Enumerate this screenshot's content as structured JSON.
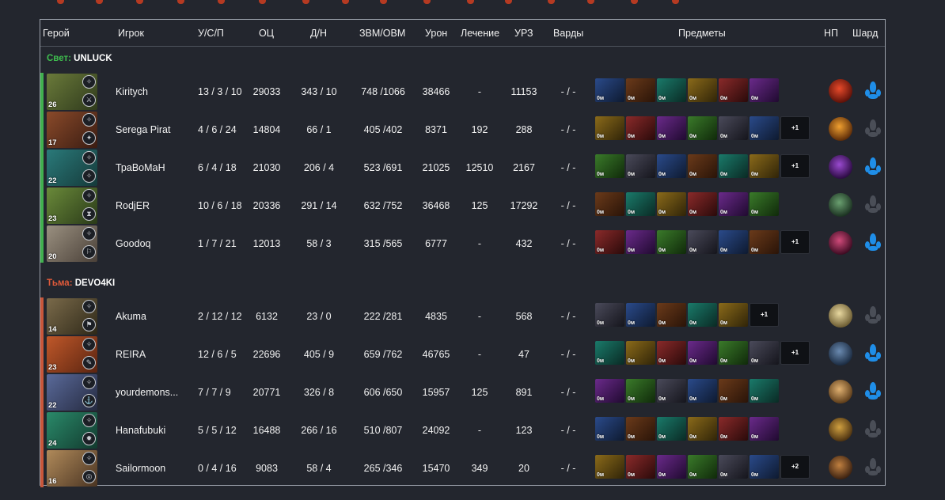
{
  "headers": {
    "hero": "Герой",
    "player": "Игрок",
    "kda": "У/С/П",
    "networth": "ОЦ",
    "lh_dn": "Д/Н",
    "gpm_xpm": "ЗВМ/ОВМ",
    "damage": "Урон",
    "healing": "Лечение",
    "tower_damage": "УРЗ",
    "wards": "Варды",
    "items": "Предметы",
    "neutral": "НП",
    "shard": "Шард"
  },
  "item_time_label": "0м",
  "radiant": {
    "side_label": "Свет:",
    "team_name": "UNLUCK",
    "players": [
      {
        "level": "26",
        "name": "Kiritych",
        "kda": "13 / 3 / 10",
        "networth": "29033",
        "lh_dn": "343 / 10",
        "gpm_xpm": "748 /1066",
        "damage": "38466",
        "healing": "-",
        "tower_damage": "11153",
        "wards": "- / -",
        "items": [
          "0м",
          "0м",
          "0м",
          "0м",
          "0м",
          "0м"
        ],
        "extra_items": "",
        "shard": true
      },
      {
        "level": "17",
        "name": "Serega Pirat",
        "kda": "4 / 6 / 24",
        "networth": "14804",
        "lh_dn": "66 / 1",
        "gpm_xpm": "405 /402",
        "damage": "8371",
        "healing": "192",
        "tower_damage": "288",
        "wards": "- / -",
        "items": [
          "0м",
          "0м",
          "0м",
          "0м",
          "0м",
          "0м"
        ],
        "extra_items": "+1",
        "shard": false
      },
      {
        "level": "22",
        "name": "ТраВоМаН",
        "kda": "6 / 4 / 18",
        "networth": "21030",
        "lh_dn": "206 / 4",
        "gpm_xpm": "523 /691",
        "damage": "21025",
        "healing": "12510",
        "tower_damage": "2167",
        "wards": "- / -",
        "items": [
          "0м",
          "0м",
          "0м",
          "0м",
          "0м",
          "0м"
        ],
        "extra_items": "+1",
        "shard": true
      },
      {
        "level": "23",
        "name": "RodjER",
        "kda": "10 / 6 / 18",
        "networth": "20336",
        "lh_dn": "291 / 14",
        "gpm_xpm": "632 /752",
        "damage": "36468",
        "healing": "125",
        "tower_damage": "17292",
        "wards": "- / -",
        "items": [
          "0м",
          "0м",
          "0м",
          "0м",
          "0м",
          "0м"
        ],
        "extra_items": "",
        "shard": false
      },
      {
        "level": "20",
        "name": "Goodoq",
        "kda": "1 / 7 / 21",
        "networth": "12013",
        "lh_dn": "58 / 3",
        "gpm_xpm": "315 /565",
        "damage": "6777",
        "healing": "-",
        "tower_damage": "432",
        "wards": "- / -",
        "items": [
          "0м",
          "0м",
          "0м",
          "0м",
          "0м",
          "0м"
        ],
        "extra_items": "+1",
        "shard": true
      }
    ]
  },
  "dire": {
    "side_label": "Тьма:",
    "team_name": "DEVO4KI",
    "players": [
      {
        "level": "14",
        "name": "Akuma",
        "kda": "2 / 12 / 12",
        "networth": "6132",
        "lh_dn": "23 / 0",
        "gpm_xpm": "222 /281",
        "damage": "4835",
        "healing": "-",
        "tower_damage": "568",
        "wards": "- / -",
        "items": [
          "0м",
          "0м",
          "0м",
          "0м",
          "0м"
        ],
        "extra_items": "+1",
        "shard": false
      },
      {
        "level": "23",
        "name": "REIRA",
        "kda": "12 / 6 / 5",
        "networth": "22696",
        "lh_dn": "405 / 9",
        "gpm_xpm": "659 /762",
        "damage": "46765",
        "healing": "-",
        "tower_damage": "47",
        "wards": "- / -",
        "items": [
          "0м",
          "0м",
          "0м",
          "0м",
          "0м",
          "0м"
        ],
        "extra_items": "+1",
        "shard": true
      },
      {
        "level": "22",
        "name": "yourdemons...",
        "kda": "7 / 7 / 9",
        "networth": "20771",
        "lh_dn": "326 / 8",
        "gpm_xpm": "606 /650",
        "damage": "15957",
        "healing": "125",
        "tower_damage": "891",
        "wards": "- / -",
        "items": [
          "0м",
          "0м",
          "0м",
          "0м",
          "0м",
          "0м"
        ],
        "extra_items": "",
        "shard": true
      },
      {
        "level": "24",
        "name": "Hanafubuki",
        "kda": "5 / 5 / 12",
        "networth": "16488",
        "lh_dn": "266 / 16",
        "gpm_xpm": "510 /807",
        "damage": "24092",
        "healing": "-",
        "tower_damage": "123",
        "wards": "- / -",
        "items": [
          "0м",
          "0м",
          "0м",
          "0м",
          "0м",
          "0м"
        ],
        "extra_items": "",
        "shard": false
      },
      {
        "level": "16",
        "name": "Sailormoon",
        "kda": "0 / 4 / 16",
        "networth": "9083",
        "lh_dn": "58 / 4",
        "gpm_xpm": "265 /346",
        "damage": "15470",
        "healing": "349",
        "tower_damage": "20",
        "wards": "- / -",
        "items": [
          "0м",
          "0м",
          "0м",
          "0м",
          "0м",
          "0м"
        ],
        "extra_items": "+2",
        "shard": false
      }
    ]
  }
}
